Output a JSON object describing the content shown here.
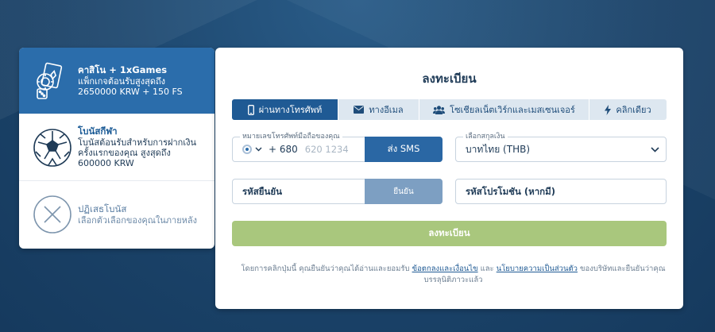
{
  "bonuses": [
    {
      "title": "คาสิโน + 1xGames",
      "desc": "แพ็กเกจต้อนรับสูงสุดถึง 2650000 KRW + 150 FS",
      "icon": "casino-icon",
      "active": true
    },
    {
      "title": "โบนัสกีฬา",
      "desc": "โบนัสต้อนรับสำหรับการฝากเงินครั้งแรกของคุณ สูงสุดถึง 600000 KRW",
      "icon": "soccer-ball-icon",
      "active": false
    },
    {
      "title": "ปฏิเสธโบนัส",
      "desc": "เลือกตัวเลือกของคุณในภายหลัง",
      "icon": "close-circle-icon",
      "active": false
    }
  ],
  "registration": {
    "title": "ลงทะเบียน",
    "tabs": [
      {
        "label": "ผ่านทางโทรศัพท์",
        "icon": "phone-icon",
        "active": true
      },
      {
        "label": "ทางอีเมล",
        "icon": "envelope-icon",
        "active": false
      },
      {
        "label": "โซเชียลเน็ตเวิร์กและเมสเซนเจอร์",
        "icon": "users-icon",
        "active": false
      },
      {
        "label": "คลิกเดียว",
        "icon": "bolt-icon",
        "active": false
      }
    ],
    "phone": {
      "label": "หมายเลขโทรศัพท์มือถือของคุณ",
      "prefix": "+ 680",
      "placeholder": "620 1234",
      "sms_button": "ส่ง SMS"
    },
    "currency": {
      "label": "เลือกสกุลเงิน",
      "value": "บาทไทย (THB)"
    },
    "confirm": {
      "placeholder": "รหัสยืนยัน",
      "button": "ยืนยัน"
    },
    "promo": {
      "placeholder": "รหัสโปรโมชัน (หากมี)"
    },
    "submit_label": "ลงทะเบียน",
    "terms": {
      "prefix": "โดยการคลิกปุ่มนี้ คุณยืนยันว่าคุณได้อ่านและยอมรับ",
      "link1": "ข้อตกลงและเงื่อนไข",
      "and": "และ",
      "link2": "นโยบายความเป็นส่วนตัว",
      "suffix": "ของบริษัทและยืนยันว่าคุณบรรลุนิติภาวะแล้ว"
    }
  },
  "colors": {
    "background": "#1d4a72",
    "active_tab": "#1f5a94",
    "submit": "#a9c77d",
    "bonus_active": "#2b6dab"
  }
}
